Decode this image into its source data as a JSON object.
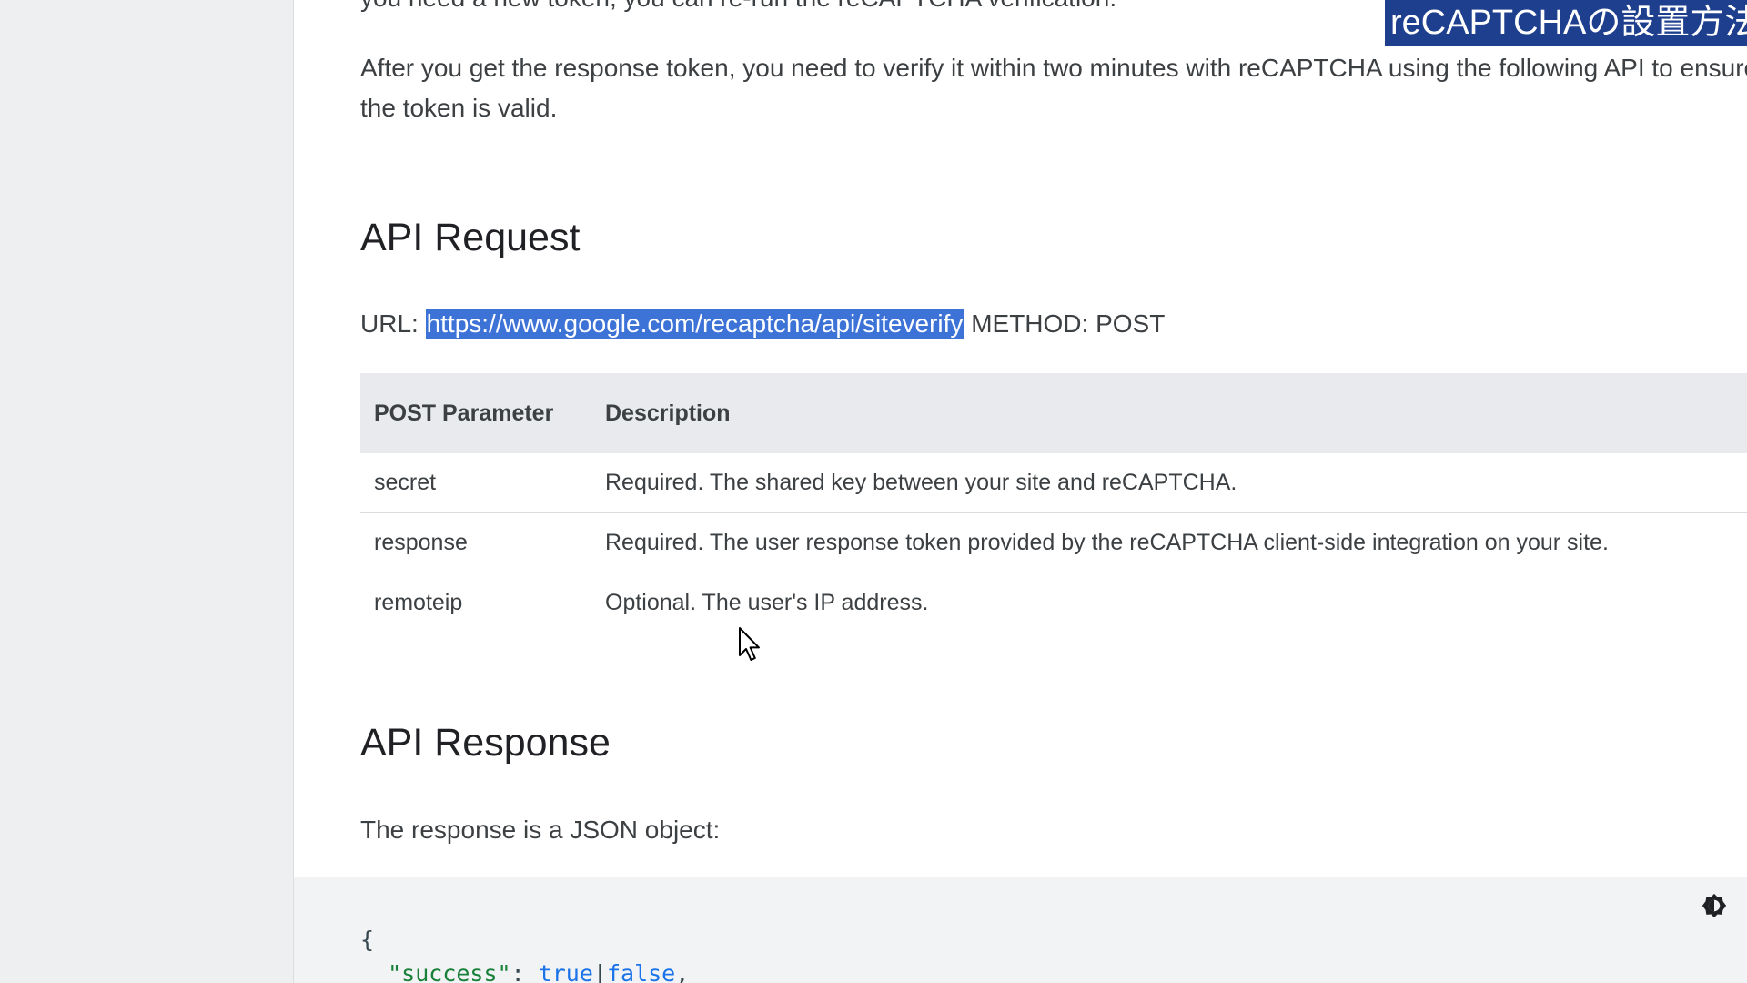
{
  "overlay": {
    "title": "reCAPTCHAの設置方法"
  },
  "content": {
    "cut_line": "you need a new token, you can re-run the reCAPTCHA verification.",
    "para_after": "After you get the response token, you need to verify it within two minutes with reCAPTCHA using the following API to ensure the token is valid.",
    "api_request": {
      "heading": "API Request",
      "url_label": "URL:",
      "url": "https://www.google.com/recaptcha/api/siteverify",
      "method": "METHOD: POST"
    },
    "table": {
      "headers": [
        "POST Parameter",
        "Description"
      ],
      "rows": [
        {
          "param": "secret",
          "desc": "Required. The shared key between your site and reCAPTCHA."
        },
        {
          "param": "response",
          "desc": "Required. The user response token provided by the reCAPTCHA client-side integration on your site."
        },
        {
          "param": "remoteip",
          "desc": "Optional. The user's IP address."
        }
      ]
    },
    "api_response": {
      "heading": "API Response",
      "intro": "The response is a JSON object:"
    },
    "code": {
      "line1": "{",
      "key": "\"success\"",
      "colon": ": ",
      "val_true": "true",
      "pipe": "|",
      "val_false": "false",
      "comma": ","
    }
  },
  "icons": {
    "theme_toggle": "brightness-icon",
    "cursor": "mouse-pointer-icon"
  },
  "colors": {
    "overlay_bg": "#1e3e8e",
    "selection": "#3d73d6",
    "table_header_bg": "#e8eaed",
    "code_bg": "#f1f3f4",
    "string": "#188038",
    "keyword": "#1a73e8"
  }
}
